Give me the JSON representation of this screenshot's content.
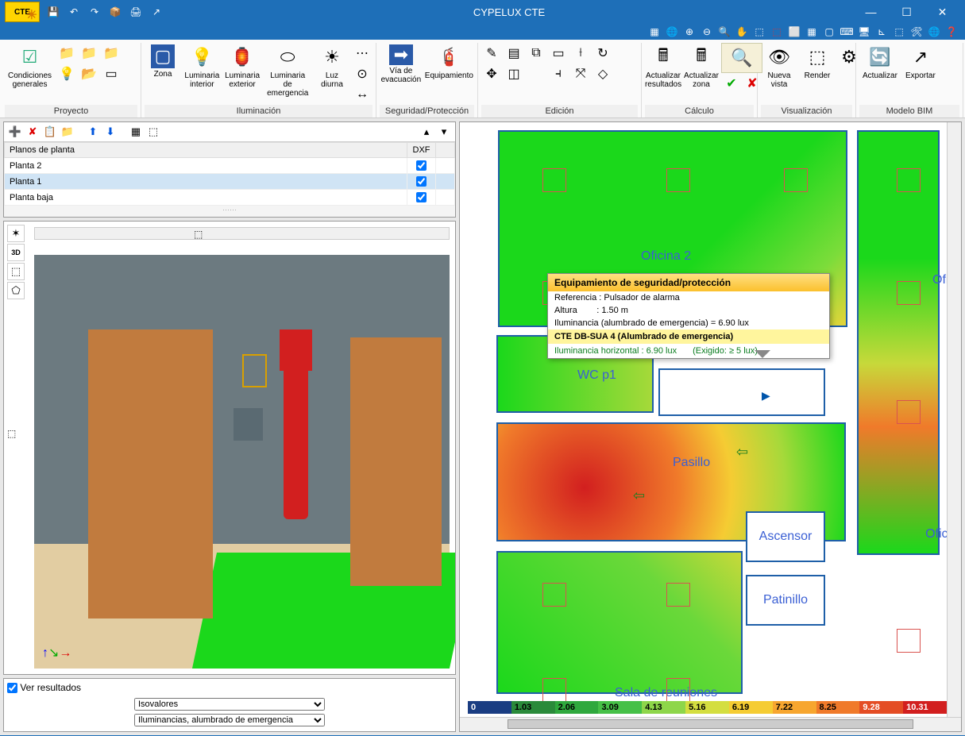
{
  "app_title": "CYPELUX CTE",
  "ribbon": {
    "groups": [
      {
        "label": "Proyecto",
        "items": [
          {
            "icon": "☑",
            "label": "Condiciones\ngenerales"
          }
        ]
      },
      {
        "label": "Iluminación",
        "items": [
          {
            "icon": "▦",
            "label": "Zona"
          },
          {
            "icon": "💡",
            "label": "Luminaria\ninterior"
          },
          {
            "icon": "🕯",
            "label": "Luminaria\nexterior"
          },
          {
            "icon": "⬭",
            "label": "Luminaria de\nemergencia"
          },
          {
            "icon": "☀",
            "label": "Luz\ndiurna"
          }
        ]
      },
      {
        "label": "Seguridad/Protección",
        "items": [
          {
            "icon": "➡",
            "label": "Vía de\nevacuación"
          },
          {
            "icon": "🧯",
            "label": "Equipamiento"
          }
        ]
      },
      {
        "label": "Edición",
        "items": []
      },
      {
        "label": "Cálculo",
        "items": [
          {
            "icon": "🖩",
            "label": "Actualizar\nresultados"
          },
          {
            "icon": "🖩",
            "label": "Actualizar\nzona"
          },
          {
            "icon": "🔍",
            "label": ""
          }
        ]
      },
      {
        "label": "Visualización",
        "items": [
          {
            "icon": "👁",
            "label": "Nueva\nvista"
          },
          {
            "icon": "⬚",
            "label": "Render"
          },
          {
            "icon": "⚙",
            "label": ""
          }
        ]
      },
      {
        "label": "Modelo BIM",
        "items": [
          {
            "icon": "🔄",
            "label": "Actualizar"
          },
          {
            "icon": "↗",
            "label": "Exportar"
          }
        ]
      }
    ]
  },
  "plan_panel": {
    "header": "Planos de planta",
    "dxf": "DXF",
    "rows": [
      {
        "name": "Planta 2",
        "dxf": true,
        "sel": false
      },
      {
        "name": "Planta 1",
        "dxf": true,
        "sel": true
      },
      {
        "name": "Planta baja",
        "dxf": true,
        "sel": false
      }
    ]
  },
  "results": {
    "checkbox": "Ver resultados",
    "select1": "Isovalores",
    "select2": "Iluminancias, alumbrado de emergencia"
  },
  "tooltip": {
    "title": "Equipamiento de seguridad/protección",
    "ref_label": "Referencia",
    "ref_value": "Pulsador de alarma",
    "alt_label": "Altura",
    "alt_value": "1.50 m",
    "ilum": "Iluminancia (alumbrado de emergencia) = 6.90 lux",
    "section": "CTE DB-SUA 4 (Alumbrado de emergencia)",
    "ih_label": "Iluminancia horizontal",
    "ih_value": "6.90 lux",
    "req": "(Exigido: ≥ 5 lux)"
  },
  "zones": {
    "oficina2": "Oficina 2",
    "oficina": "Ofici",
    "wc": "WC p1",
    "pasillo": "Pasillo",
    "ascensor": "Ascensor",
    "patinillo": "Patinillo",
    "sala": "Sala de reuniones",
    "oficin": "Oficin"
  },
  "legend": [
    {
      "v": "0",
      "c": "#1a3d82"
    },
    {
      "v": "1.03",
      "c": "#2a8a3a"
    },
    {
      "v": "2.06",
      "c": "#2fa83d"
    },
    {
      "v": "3.09",
      "c": "#46c047"
    },
    {
      "v": "4.13",
      "c": "#8ed64a"
    },
    {
      "v": "5.16",
      "c": "#d4de40"
    },
    {
      "v": "6.19",
      "c": "#f5cc33"
    },
    {
      "v": "7.22",
      "c": "#f7a62f"
    },
    {
      "v": "8.25",
      "c": "#f07a2a"
    },
    {
      "v": "9.28",
      "c": "#e44d24"
    },
    {
      "v": "10.31",
      "c": "#d21f1f"
    }
  ]
}
